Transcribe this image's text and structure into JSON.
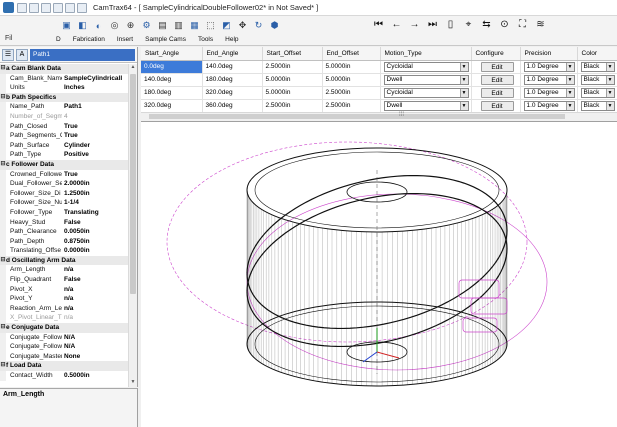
{
  "window": {
    "title": "CamTrax64 - [ SampleCylindricalDoubleFollower02*  in  Not Saved* ]"
  },
  "menu": {
    "file_tab": "Fil",
    "items": [
      "D",
      "Fabrication",
      "Insert",
      "Sample Cams",
      "Tools",
      "Help"
    ]
  },
  "left_toolbar": {
    "selected_path": "Path1"
  },
  "properties": [
    {
      "cat": "a Cam Blank Data"
    },
    {
      "k": "Cam_Blank_Name",
      "v": "SampleCylindricalI"
    },
    {
      "k": "Units",
      "v": "Inches"
    },
    {
      "cat": "b Path Specifics"
    },
    {
      "k": "Name_Path",
      "v": "Path1"
    },
    {
      "k": "Number_of_Segm",
      "v": "4",
      "dim": true
    },
    {
      "k": "Path_Closed",
      "v": "True"
    },
    {
      "k": "Path_Segments_C",
      "v": "True"
    },
    {
      "k": "Path_Surface",
      "v": "Cylinder"
    },
    {
      "k": "Path_Type",
      "v": "Positive"
    },
    {
      "cat": "c Follower Data"
    },
    {
      "k": "Crowned_Followe",
      "v": "True"
    },
    {
      "k": "Dual_Follower_Se",
      "v": "2.0000in"
    },
    {
      "k": "Follower_Size_Di",
      "v": "1.2500in"
    },
    {
      "k": "Follower_Size_Nu",
      "v": "1-1/4"
    },
    {
      "k": "Follower_Type",
      "v": "Translating"
    },
    {
      "k": "Heavy_Stud",
      "v": "False"
    },
    {
      "k": "Path_Clearance",
      "v": "0.0050in"
    },
    {
      "k": "Path_Depth",
      "v": "0.8750in"
    },
    {
      "k": "Translating_Offse",
      "v": "0.0000in"
    },
    {
      "cat": "d Oscillating Arm Data"
    },
    {
      "k": "Arm_Length",
      "v": "n/a"
    },
    {
      "k": "Flip_Quadrant",
      "v": "False"
    },
    {
      "k": "Pivot_X",
      "v": "n/a"
    },
    {
      "k": "Pivot_Y",
      "v": "n/a"
    },
    {
      "k": "Reaction_Arm_Le",
      "v": "n/a"
    },
    {
      "k": "X_Pivot_Linear_T",
      "v": "n/a",
      "dim": true
    },
    {
      "cat": "e Conjugate Data"
    },
    {
      "k": "Conjugate_Follow",
      "v": "N/A"
    },
    {
      "k": "Conjugate_Follow",
      "v": "N/A"
    },
    {
      "k": "Conjugate_Master",
      "v": "None"
    },
    {
      "cat": "f Load Data"
    },
    {
      "k": "Contact_Width",
      "v": "0.5000in"
    }
  ],
  "description": {
    "title": "Arm_Length"
  },
  "grid": {
    "headers": [
      "Start_Angle",
      "End_Angle",
      "Start_Offset",
      "End_Offset",
      "Motion_Type",
      "Configure",
      "Precision",
      "Color"
    ],
    "edit_label": "Edit",
    "rows": [
      {
        "start": "0.0deg",
        "end": "140.0deg",
        "soff": "2.5000in",
        "eoff": "5.0000in",
        "motion": "Cycloidal",
        "precision": "1.0 Degree",
        "color": "Black"
      },
      {
        "start": "140.0deg",
        "end": "180.0deg",
        "soff": "5.0000in",
        "eoff": "5.0000in",
        "motion": "Dwell",
        "precision": "1.0 Degree",
        "color": "Black"
      },
      {
        "start": "180.0deg",
        "end": "320.0deg",
        "soff": "5.0000in",
        "eoff": "2.5000in",
        "motion": "Cycloidal",
        "precision": "1.0 Degree",
        "color": "Black"
      },
      {
        "start": "320.0deg",
        "end": "360.0deg",
        "soff": "2.5000in",
        "eoff": "2.5000in",
        "motion": "Dwell",
        "precision": "1.0 Degree",
        "color": "Black"
      }
    ]
  },
  "icons": {
    "new": "new-file-icon",
    "open": "open-folder-icon",
    "save": "save-icon",
    "undo": "undo-icon",
    "first": "first-icon",
    "prev": "previous-icon",
    "next": "next-icon",
    "last": "last-icon",
    "zoom": "zoom-icon",
    "view": "view-icon"
  },
  "colors": {
    "selection": "#3d7bd9",
    "cam_lines": "#333333",
    "follower_lines": "#cc44cc"
  }
}
